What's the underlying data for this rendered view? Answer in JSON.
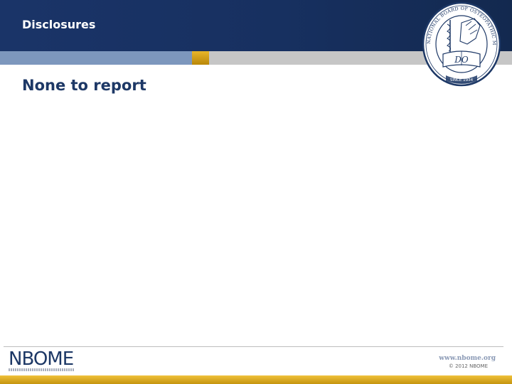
{
  "slide": {
    "title": "Disclosures",
    "body_text": "None to report"
  },
  "seal": {
    "text": "NATIONAL BOARD OF OSTEOPATHIC MEDICAL EXAMINERS",
    "initials": "DO",
    "since": "SINCE 1934"
  },
  "footer": {
    "logo_text": "NBOME",
    "logo_subtext": "NATIONAL BOARD OF OSTEOPATHIC MEDICAL EXAMINERS",
    "url": "www.nbome.org",
    "copyright": "© 2012 NBOME"
  },
  "colors": {
    "header_navy": "#1a3468",
    "band_blue": "#7d97bd",
    "accent_gold": "#e0aa1e",
    "band_gray": "#c6c6c6",
    "text_navy": "#1d3866"
  }
}
